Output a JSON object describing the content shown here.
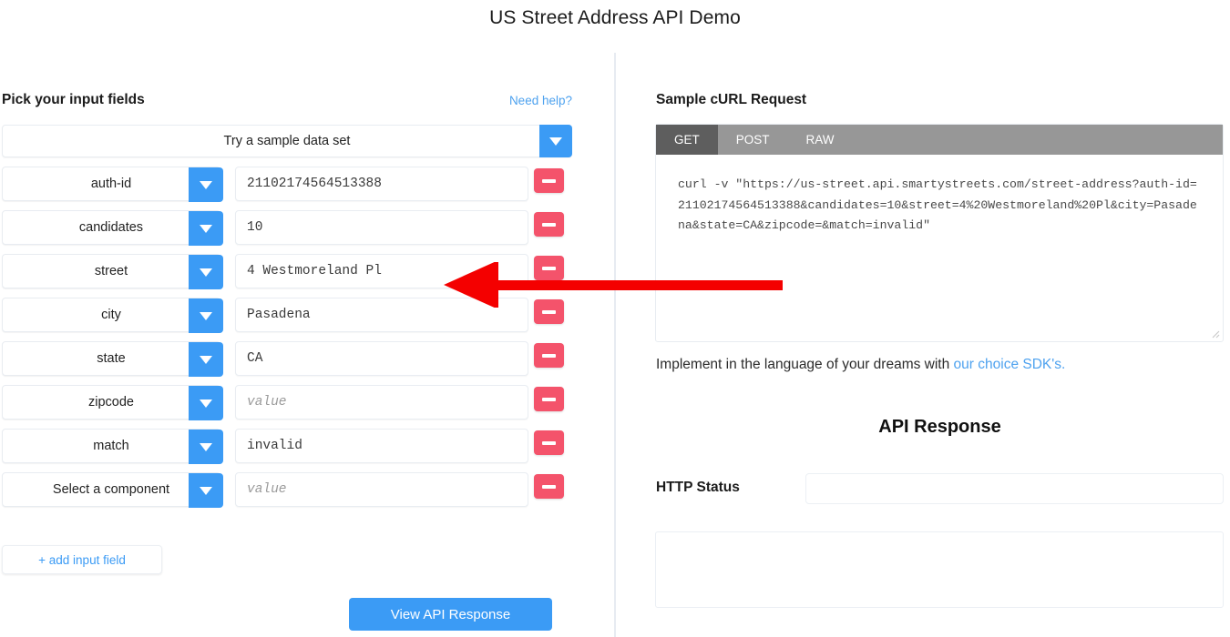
{
  "header": {
    "title": "US Street Address API Demo"
  },
  "left": {
    "title": "Pick your input fields",
    "need_help": "Need help?",
    "sample_select": "Try a sample data set",
    "add_field_label": "+ add input field",
    "view_response_label": "View API Response",
    "value_placeholder": "value",
    "fields": [
      {
        "name": "auth-id",
        "value": "21102174564513388"
      },
      {
        "name": "candidates",
        "value": "10"
      },
      {
        "name": "street",
        "value": "4 Westmoreland Pl"
      },
      {
        "name": "city",
        "value": "Pasadena"
      },
      {
        "name": "state",
        "value": "CA"
      },
      {
        "name": "zipcode",
        "value": ""
      },
      {
        "name": "match",
        "value": "invalid"
      },
      {
        "name": "Select a component",
        "value": ""
      }
    ]
  },
  "right": {
    "curl_title": "Sample cURL Request",
    "tabs": [
      {
        "label": "GET",
        "active": true
      },
      {
        "label": "POST",
        "active": false
      },
      {
        "label": "RAW",
        "active": false
      }
    ],
    "curl_text": "curl -v \"https://us-street.api.smartystreets.com/street-address?auth-id=21102174564513388&candidates=10&street=4%20Westmoreland%20Pl&city=Pasadena&state=CA&zipcode=&match=invalid\"",
    "sdk_text": "Implement in the language of your dreams with ",
    "sdk_link": "our choice SDK's.",
    "api_response_title": "API Response",
    "http_status_label": "HTTP Status",
    "http_status_value": ""
  },
  "annotation": {
    "arrow_color": "#f40000",
    "points_to": "street value input"
  },
  "colors": {
    "accent_blue": "#3b9bf5",
    "link_blue": "#4ea2ef",
    "remove_red": "#f4536b",
    "tabbar_gray": "#979797",
    "tab_active_gray": "#5e5e5e",
    "divider": "#e7ebf1"
  }
}
